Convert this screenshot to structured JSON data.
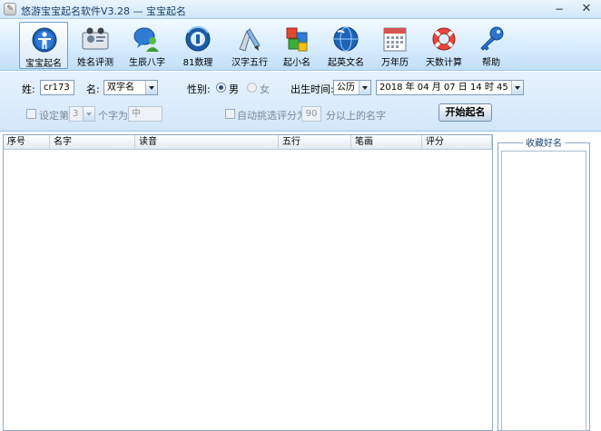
{
  "window": {
    "title": "悠游宝宝起名软件V3.28 — 宝宝起名",
    "minimize": "−",
    "close": "✕"
  },
  "toolbar": {
    "items": [
      {
        "label": "宝宝起名",
        "icon": "person-badge-icon"
      },
      {
        "label": "姓名评测",
        "icon": "id-card-icon"
      },
      {
        "label": "生辰八字",
        "icon": "chat-person-icon"
      },
      {
        "label": "81数理",
        "icon": "globe-81-icon"
      },
      {
        "label": "汉字五行",
        "icon": "brush-icon"
      },
      {
        "label": "起小名",
        "icon": "blocks-icon"
      },
      {
        "label": "起英文名",
        "icon": "globe-icon"
      },
      {
        "label": "万年历",
        "icon": "calendar-icon"
      },
      {
        "label": "天数计算",
        "icon": "lifebuoy-icon"
      },
      {
        "label": "帮助",
        "icon": "key-icon"
      }
    ]
  },
  "form": {
    "surname_label": "姓:",
    "surname_value": "cr173",
    "name_label": "名:",
    "name_type": "双字名",
    "gender_label": "性别:",
    "gender_male": "男",
    "gender_female": "女",
    "birth_label": "出生时间:",
    "calendar_type": "公历",
    "birth_time": "2018 年 04 月 07 日  14 时 45 分",
    "fix_label": "设定第",
    "fix_position": "3",
    "fix_char_label": "个字为",
    "fix_char": "中",
    "auto_label": "自动挑选评分为",
    "auto_score": "90",
    "auto_suffix": "分以上的名字",
    "start_button": "开始起名"
  },
  "table": {
    "columns": [
      "序号",
      "名字",
      "读音",
      "五行",
      "笔画",
      "评分"
    ]
  },
  "favorites": {
    "title": "收藏好名"
  },
  "colors": {
    "accent": "#2b6fc1",
    "toolbar_bg": "#dcefff",
    "form_bg": "#d3e7fa"
  }
}
